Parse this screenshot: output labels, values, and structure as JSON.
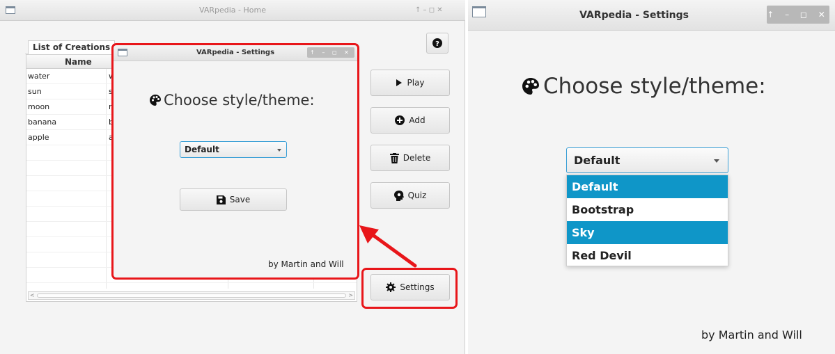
{
  "home": {
    "title": "VARpedia - Home",
    "window_controls": "↑  –  ◻  ✕",
    "help_label": "?",
    "tab_label": "List of Creations",
    "columns": [
      "Name"
    ],
    "rows": [
      {
        "name": "water",
        "second": "w"
      },
      {
        "name": "sun",
        "second": "s"
      },
      {
        "name": "moon",
        "second": "n"
      },
      {
        "name": "banana",
        "second": "b"
      },
      {
        "name": "apple",
        "second": "a"
      }
    ],
    "buttons": {
      "play": "Play",
      "add": "Add",
      "delete": "Delete",
      "quiz": "Quiz",
      "settings": "Settings"
    },
    "scroll_left": "<",
    "scroll_right": ">"
  },
  "settings_small": {
    "title": "VARpedia - Settings",
    "window_controls": "↑ – ◻ ✕",
    "heading": "Choose style/theme:",
    "combo_value": "Default",
    "save_label": "Save",
    "credit": "by Martin and Will"
  },
  "settings_large": {
    "title": "VARpedia - Settings",
    "window_controls": "↑ – ◻ ✕",
    "heading": "Choose style/theme:",
    "combo_value": "Default",
    "options": [
      "Default",
      "Bootstrap",
      "Sky",
      "Red Devil"
    ],
    "selected_options": [
      "Default",
      "Sky"
    ],
    "credit": "by Martin and Will"
  },
  "colors": {
    "highlight": "#e8161a",
    "selection": "#0f96c8",
    "focus_border": "#3a9fd6"
  }
}
